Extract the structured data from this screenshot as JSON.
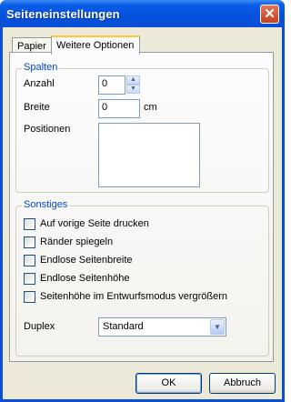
{
  "window": {
    "title": "Seiteneinstellungen",
    "close": "✕"
  },
  "tabs": [
    {
      "label": "Papier",
      "active": false
    },
    {
      "label": "Weitere Optionen",
      "active": true
    }
  ],
  "spalten": {
    "title": "Spalten",
    "anzahl_label": "Anzahl",
    "anzahl_value": "0",
    "breite_label": "Breite",
    "breite_value": "0",
    "breite_unit": "cm",
    "positionen_label": "Positionen"
  },
  "sonstiges": {
    "title": "Sonstiges",
    "options": [
      {
        "label": "Auf vorige Seite drucken",
        "checked": false
      },
      {
        "label": "Ränder spiegeln",
        "checked": false
      },
      {
        "label": "Endlose Seitenbreite",
        "checked": false
      },
      {
        "label": "Endlose Seitenhöhe",
        "checked": false
      },
      {
        "label": "Seitenhöhe im Entwurfsmodus vergrößern",
        "checked": false
      }
    ],
    "duplex_label": "Duplex",
    "duplex_value": "Standard"
  },
  "buttons": {
    "ok": "OK",
    "cancel": "Abbruch"
  }
}
